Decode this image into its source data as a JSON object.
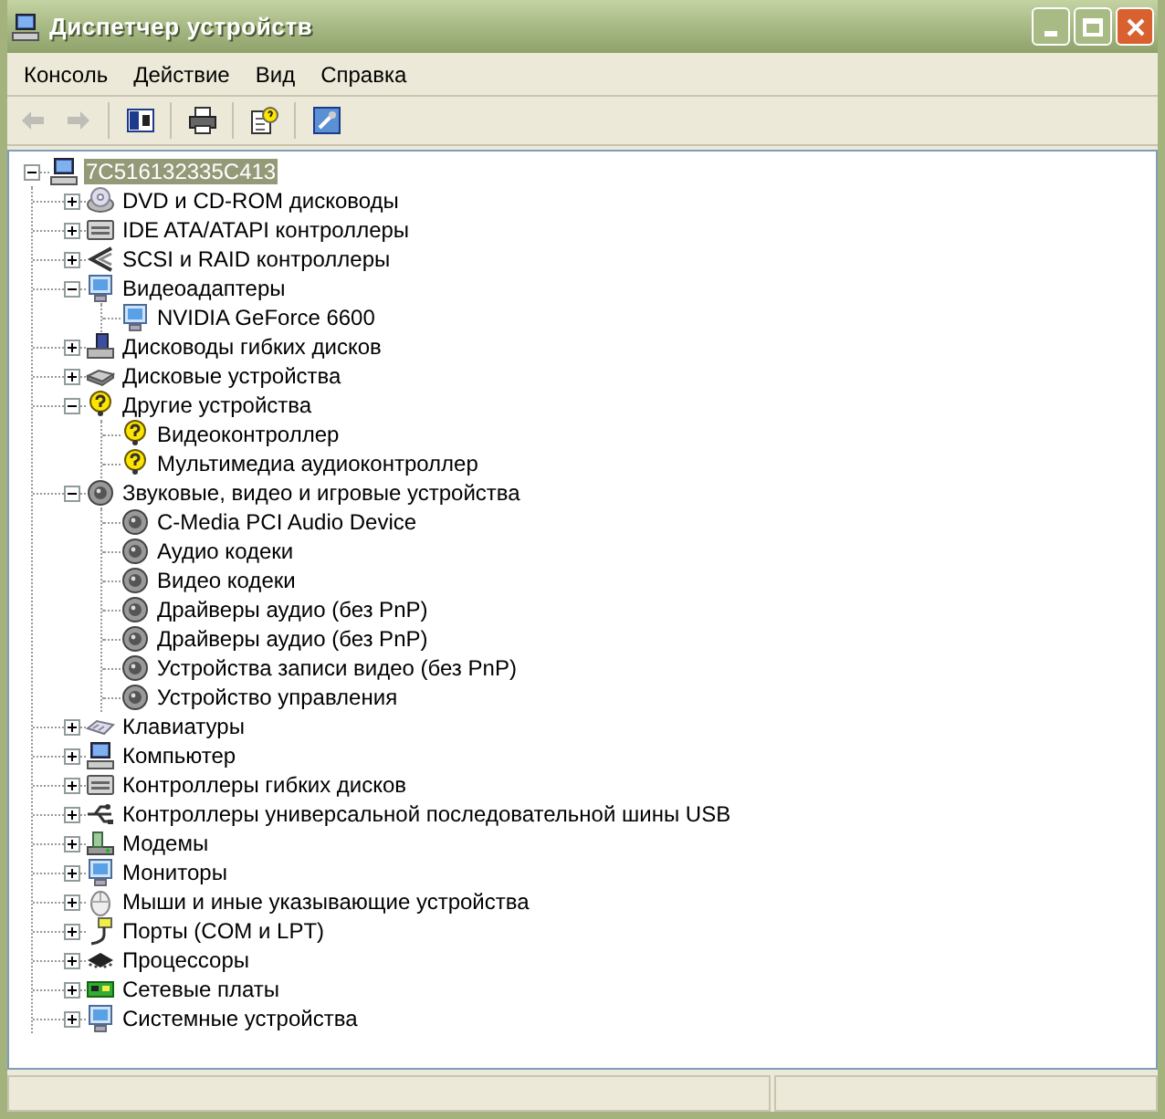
{
  "window": {
    "title": "Диспетчер устройств"
  },
  "menu": [
    "Консоль",
    "Действие",
    "Вид",
    "Справка"
  ],
  "toolbar": [
    {
      "kind": "back",
      "disabled": true
    },
    {
      "kind": "forward",
      "disabled": true
    },
    {
      "kind": "tree",
      "disabled": false
    },
    {
      "kind": "print",
      "disabled": false
    },
    {
      "kind": "help",
      "disabled": false
    },
    {
      "kind": "properties",
      "disabled": false
    }
  ],
  "tree": {
    "label": "7C516132335C413",
    "selected": true,
    "expanded": true,
    "children": [
      {
        "label": "DVD и CD-ROM дисководы",
        "selected": false,
        "expanded": false
      },
      {
        "label": "IDE ATA/ATAPI контроллеры",
        "selected": false,
        "expanded": false
      },
      {
        "label": "SCSI и RAID контроллеры",
        "selected": false,
        "expanded": false
      },
      {
        "label": "Видеоадаптеры",
        "selected": false,
        "expanded": true,
        "children": [
          {
            "label": "NVIDIA GeForce 6600",
            "selected": false
          }
        ]
      },
      {
        "label": "Дисководы гибких дисков",
        "selected": false,
        "expanded": false
      },
      {
        "label": "Дисковые устройства",
        "selected": false,
        "expanded": false
      },
      {
        "label": "Другие устройства",
        "selected": false,
        "expanded": true,
        "children": [
          {
            "label": "Видеоконтроллер",
            "selected": false
          },
          {
            "label": "Мультимедиа аудиоконтроллер",
            "selected": false
          }
        ]
      },
      {
        "label": "Звуковые, видео и игровые устройства",
        "selected": false,
        "expanded": true,
        "children": [
          {
            "label": "C-Media PCI Audio Device",
            "selected": false
          },
          {
            "label": "Аудио кодеки",
            "selected": false
          },
          {
            "label": "Видео кодеки",
            "selected": false
          },
          {
            "label": "Драйверы аудио (без PnP)",
            "selected": false
          },
          {
            "label": "Драйверы аудио (без PnP)",
            "selected": false
          },
          {
            "label": "Устройства записи видео (без PnP)",
            "selected": false
          },
          {
            "label": "Устройство управления",
            "selected": false
          }
        ]
      },
      {
        "label": "Клавиатуры",
        "selected": false,
        "expanded": false
      },
      {
        "label": "Компьютер",
        "selected": false,
        "expanded": false
      },
      {
        "label": "Контроллеры гибких дисков",
        "selected": false,
        "expanded": false
      },
      {
        "label": "Контроллеры универсальной последовательной шины USB",
        "selected": false,
        "expanded": false
      },
      {
        "label": "Модемы",
        "selected": false,
        "expanded": false
      },
      {
        "label": "Мониторы",
        "selected": false,
        "expanded": false
      },
      {
        "label": "Мыши и иные указывающие устройства",
        "selected": false,
        "expanded": false
      },
      {
        "label": "Порты (COM и LPT)",
        "selected": false,
        "expanded": false
      },
      {
        "label": "Процессоры",
        "selected": false,
        "expanded": false
      },
      {
        "label": "Сетевые платы",
        "selected": false,
        "expanded": false
      },
      {
        "label": "Системные устройства",
        "selected": false,
        "expanded": false
      }
    ]
  }
}
